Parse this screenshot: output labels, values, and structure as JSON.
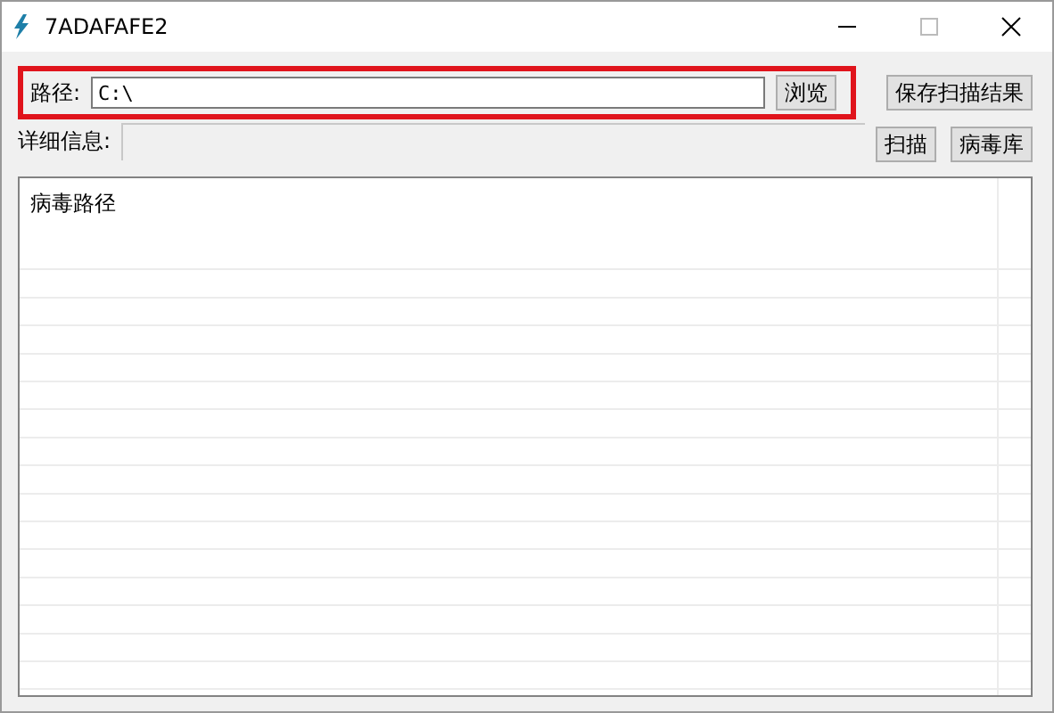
{
  "window": {
    "title": "7ADAFAFE2"
  },
  "path_row": {
    "label": "路径:",
    "value": "C:\\",
    "browse_button": "浏览"
  },
  "save_button": "保存扫描结果",
  "detail_row": {
    "label": "详细信息:"
  },
  "buttons": [
    "扫描",
    "病毒库"
  ],
  "list": {
    "columns": [
      "病毒路径"
    ]
  }
}
